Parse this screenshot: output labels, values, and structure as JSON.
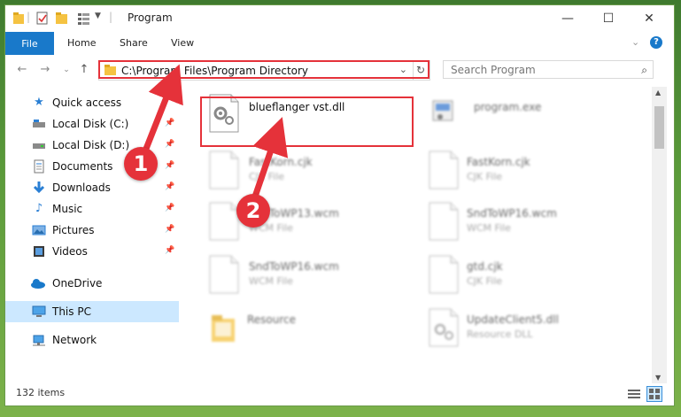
{
  "window": {
    "title": "Program",
    "status": "132 items"
  },
  "ribbon": {
    "tabs": [
      "File",
      "Home",
      "Share",
      "View"
    ]
  },
  "address": {
    "path": "C:\\Program Files\\Program Directory",
    "search_placeholder": "Search Program"
  },
  "sidebar": {
    "items": [
      {
        "label": "Quick access",
        "icon": "star-icon"
      },
      {
        "label": "Local Disk (C:)",
        "icon": "drive-icon",
        "pinned": true
      },
      {
        "label": "Local Disk (D:)",
        "icon": "drive-icon",
        "pinned": true
      },
      {
        "label": "Documents",
        "icon": "documents-icon",
        "pinned": true
      },
      {
        "label": "Downloads",
        "icon": "downloads-icon",
        "pinned": true
      },
      {
        "label": "Music",
        "icon": "music-icon",
        "pinned": true
      },
      {
        "label": "Pictures",
        "icon": "pictures-icon",
        "pinned": true
      },
      {
        "label": "Videos",
        "icon": "videos-icon",
        "pinned": true
      },
      {
        "label": "OneDrive",
        "icon": "cloud-icon"
      },
      {
        "label": "This PC",
        "icon": "computer-icon",
        "selected": true
      },
      {
        "label": "Network",
        "icon": "network-icon"
      }
    ]
  },
  "files": [
    {
      "name": "blueflanger vst.dll",
      "type": "",
      "icon": "dll-file-icon"
    },
    {
      "name": "program.exe",
      "type": "",
      "icon": "exe-file-icon"
    },
    {
      "name": "FastKorn.cjk",
      "type": "CJK File",
      "icon": "file-icon"
    },
    {
      "name": "FastKorn.cjk",
      "type": "CJK File",
      "icon": "file-icon"
    },
    {
      "name": "SndToWP13.wcm",
      "type": "WCM File",
      "icon": "file-icon"
    },
    {
      "name": "SndToWP16.wcm",
      "type": "WCM File",
      "icon": "file-icon"
    },
    {
      "name": "SndToWP16.wcm",
      "type": "WCM File",
      "icon": "file-icon"
    },
    {
      "name": "gtd.cjk",
      "type": "CJK File",
      "icon": "file-icon"
    },
    {
      "name": "Resource",
      "type": "",
      "icon": "folder-icon"
    },
    {
      "name": "UpdateClient5.dll",
      "type": "Resource DLL",
      "icon": "dll-file-icon"
    }
  ],
  "annotations": {
    "step1": "1",
    "step2": "2"
  },
  "colors": {
    "accent": "#1979ca",
    "highlight": "#e5323a",
    "selection": "#cce8ff"
  }
}
